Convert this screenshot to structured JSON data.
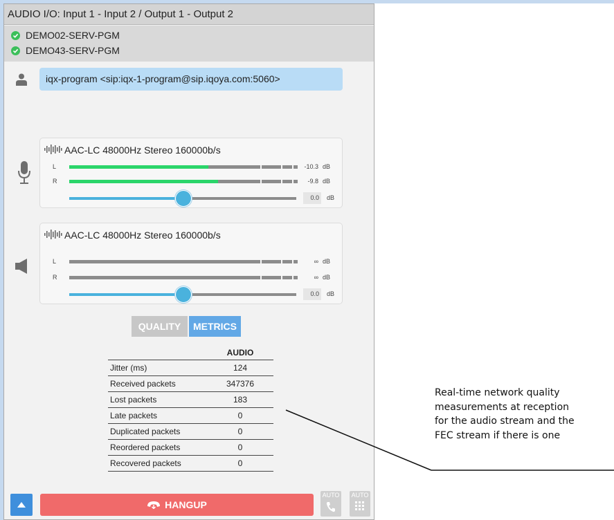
{
  "header": {
    "title": "AUDIO I/O: Input 1 - Input 2 / Output 1 - Output 2"
  },
  "servers": [
    {
      "name": "DEMO02-SERV-PGM",
      "status": "ok"
    },
    {
      "name": "DEMO43-SERV-PGM",
      "status": "ok"
    }
  ],
  "contact": {
    "sip": "iqx-program <sip:iqx-1-program@sip.iqoya.com:5060>"
  },
  "input_card": {
    "codec": "AAC-LC 48000Hz Stereo 160000b/s",
    "meters": [
      {
        "channel": "L",
        "value": "-10.3",
        "unit": "dB",
        "level": 0.61
      },
      {
        "channel": "R",
        "value": "-9.8",
        "unit": "dB",
        "level": 0.65
      }
    ],
    "gain": {
      "value": "0.0",
      "unit": "dB",
      "position": 0.5
    }
  },
  "output_card": {
    "codec": "AAC-LC 48000Hz Stereo 160000b/s",
    "meters": [
      {
        "channel": "L",
        "value": "∞",
        "unit": "dB",
        "level": 0
      },
      {
        "channel": "R",
        "value": "∞",
        "unit": "dB",
        "level": 0
      }
    ],
    "gain": {
      "value": "0.0",
      "unit": "dB",
      "position": 0.5
    }
  },
  "tabs": [
    {
      "label": "QUALITY",
      "active": false
    },
    {
      "label": "METRICS",
      "active": true
    }
  ],
  "metrics": {
    "column": "AUDIO",
    "rows": [
      {
        "label": "Jitter (ms)",
        "value": "124"
      },
      {
        "label": "Received packets",
        "value": "347376"
      },
      {
        "label": "Lost packets",
        "value": "183"
      },
      {
        "label": "Late packets",
        "value": "0"
      },
      {
        "label": "Duplicated packets",
        "value": "0"
      },
      {
        "label": "Reordered packets",
        "value": "0"
      },
      {
        "label": "Recovered packets",
        "value": "0"
      }
    ]
  },
  "footer": {
    "hangup_label": "HANGUP",
    "auto_answer_label": "AUTO",
    "auto_dial_label": "AUTO"
  },
  "annotation": {
    "lines": [
      "Real-time network quality",
      "measurements at reception",
      "for the audio stream and the",
      "FEC stream if there is one"
    ]
  },
  "colors": {
    "meter_green": "#2bd56a",
    "slider_blue": "#4ab2dd",
    "hangup_red": "#f06a6a",
    "metrics_tab_blue": "#62a8e6",
    "sip_bg": "#b9dcf6",
    "ok_green": "#3cbf5a"
  }
}
